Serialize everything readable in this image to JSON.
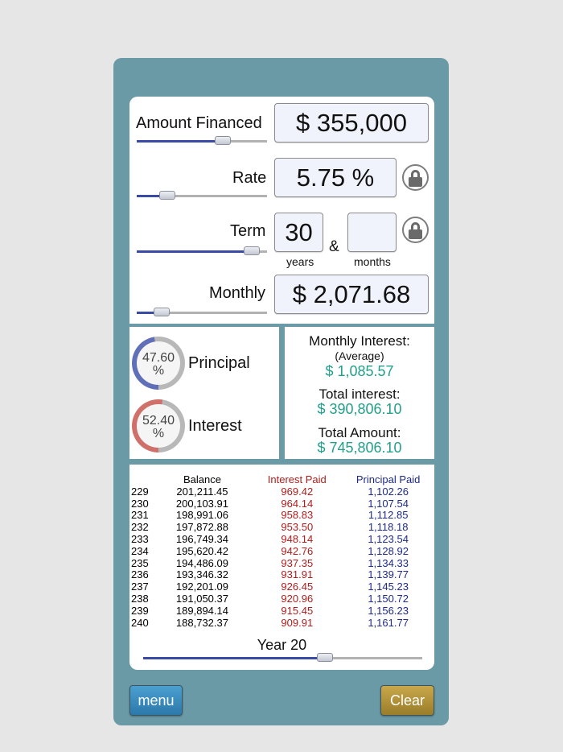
{
  "inputs": {
    "amount": {
      "label": "Amount Financed",
      "value": "$ 355,000",
      "slider_fraction": 0.68
    },
    "rate": {
      "label": "Rate",
      "value": "5.75 %",
      "slider_fraction": 0.2
    },
    "term": {
      "label": "Term",
      "years": "30",
      "months": "",
      "years_label": "years",
      "months_label": "months",
      "joiner": "&",
      "slider_fraction": 0.94
    },
    "monthly": {
      "label": "Monthly",
      "value": "$ 2,071.68",
      "slider_fraction": 0.15
    }
  },
  "breakdown": {
    "principal": {
      "percent": "47.60",
      "unit": "%",
      "label": "Principal",
      "fraction": 0.476,
      "color": "#6070b8"
    },
    "interest": {
      "percent": "52.40",
      "unit": "%",
      "label": "Interest",
      "fraction": 0.524,
      "color": "#d0706a"
    },
    "ring_bg": "#b8b8b8"
  },
  "totals": {
    "monthly_interest_label": "Monthly Interest:",
    "average_label": "(Average)",
    "monthly_interest_value": "$ 1,085.57",
    "total_interest_label": "Total interest:",
    "total_interest_value": "$ 390,806.10",
    "total_amount_label": "Total Amount:",
    "total_amount_value": "$ 745,806.10"
  },
  "schedule": {
    "headers": {
      "balance": "Balance",
      "interest": "Interest Paid",
      "principal": "Principal Paid"
    },
    "rows": [
      [
        "229",
        "201,211.45",
        "969.42",
        "1,102.26"
      ],
      [
        "230",
        "200,103.91",
        "964.14",
        "1,107.54"
      ],
      [
        "231",
        "198,991.06",
        "958.83",
        "1,112.85"
      ],
      [
        "232",
        "197,872.88",
        "953.50",
        "1,118.18"
      ],
      [
        "233",
        "196,749.34",
        "948.14",
        "1,123.54"
      ],
      [
        "234",
        "195,620.42",
        "942.76",
        "1,128.92"
      ],
      [
        "235",
        "194,486.09",
        "937.35",
        "1,134.33"
      ],
      [
        "236",
        "193,346.32",
        "931.91",
        "1,139.77"
      ],
      [
        "237",
        "192,201.09",
        "926.45",
        "1,145.23"
      ],
      [
        "238",
        "191,050.37",
        "920.96",
        "1,150.72"
      ],
      [
        "239",
        "189,894.14",
        "915.45",
        "1,156.23"
      ],
      [
        "240",
        "188,732.37",
        "909.91",
        "1,161.77"
      ]
    ],
    "year_label": "Year 20",
    "slider_fraction": 0.66
  },
  "buttons": {
    "menu": "menu",
    "clear": "Clear"
  }
}
